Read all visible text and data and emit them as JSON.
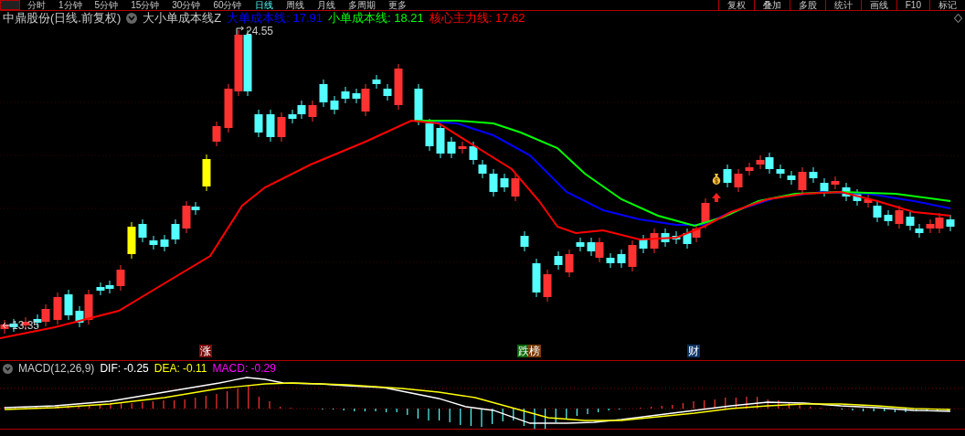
{
  "toolbar": {
    "periods": [
      {
        "label": "分时",
        "selected": false
      },
      {
        "label": "1分钟",
        "selected": false
      },
      {
        "label": "5分钟",
        "selected": false
      },
      {
        "label": "15分钟",
        "selected": false
      },
      {
        "label": "30分钟",
        "selected": false
      },
      {
        "label": "60分钟",
        "selected": false
      },
      {
        "label": "日线",
        "selected": true
      },
      {
        "label": "周线",
        "selected": false
      },
      {
        "label": "月线",
        "selected": false
      },
      {
        "label": "多周期",
        "selected": false
      },
      {
        "label": "更多",
        "selected": false
      }
    ],
    "tools": [
      "复权",
      "叠加",
      "多股",
      "统计",
      "画线",
      "F10",
      "标记"
    ]
  },
  "legend": {
    "stock": "中鼎股份(日线.前复权)",
    "indicator": "大小单成本线Z",
    "lines": [
      {
        "label": "大单成本线: 17.91",
        "color": "#0000ff"
      },
      {
        "label": "小单成本线: 18.21",
        "color": "#00ff00"
      },
      {
        "label": "核心主力线: 17.62",
        "color": "#ff0000"
      }
    ]
  },
  "price_chart": {
    "high_label": "24.55",
    "low_label": "13.35",
    "events": [
      {
        "text": "涨",
        "color": "#7a0a0a"
      },
      {
        "text": "跌",
        "color": "#0a6a0a"
      },
      {
        "text": "榜",
        "color": "#7a3a0a"
      },
      {
        "text": "财",
        "color": "#0a3366"
      }
    ]
  },
  "macd": {
    "title": "MACD(12,26,9)",
    "values": [
      {
        "label": "DIF: -0.25",
        "color": "#ffffff"
      },
      {
        "label": "DEA: -0.11",
        "color": "#ffff00"
      },
      {
        "label": "MACD: -0.29",
        "color": "#ff00ff"
      }
    ]
  }
}
